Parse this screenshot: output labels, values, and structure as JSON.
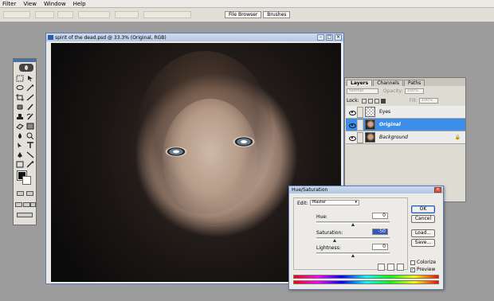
{
  "menu": [
    "Filter",
    "View",
    "Window",
    "Help"
  ],
  "palette_well": [
    "File Browser",
    "Brushes"
  ],
  "document": {
    "title": "spirit of the dead.psd @ 33.3% (Original, RGB)"
  },
  "layers_panel": {
    "tabs": [
      "Layers",
      "Channels",
      "Paths"
    ],
    "blend_mode": "Normal",
    "opacity_label": "Opacity:",
    "opacity_value": "100%",
    "lock_label": "Lock:",
    "fill_label": "Fill:",
    "fill_value": "100%",
    "layers": [
      {
        "name": "Eyes",
        "selected": false
      },
      {
        "name": "Original",
        "selected": true
      },
      {
        "name": "Background",
        "selected": false
      }
    ]
  },
  "hue_saturation": {
    "title": "Hue/Saturation",
    "edit_label": "Edit:",
    "edit_value": "Master",
    "hue_label": "Hue:",
    "hue_value": "0",
    "saturation_label": "Saturation:",
    "saturation_value": "-50",
    "lightness_label": "Lightness:",
    "lightness_value": "0",
    "buttons": [
      "OK",
      "Cancel",
      "Load...",
      "Save..."
    ],
    "colorize_label": "Colorize",
    "preview_label": "Preview",
    "colorize_checked": false,
    "preview_checked": true
  },
  "colors": {
    "selection_blue": "#3d8ee8",
    "desktop_gray": "#9c9c9c"
  }
}
